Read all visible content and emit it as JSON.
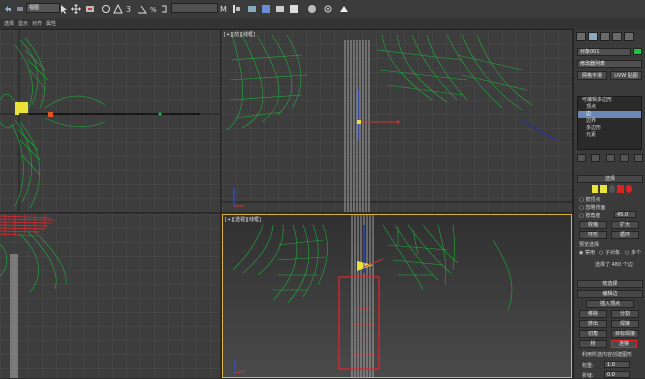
{
  "toolbar": {
    "selection_filter": "视图",
    "buttons": [
      "undo-icon",
      "redo-icon",
      "link-icon",
      "unlink-icon",
      "bind-icon",
      "select-icon",
      "select-by-name-icon",
      "rect-region-icon",
      "window-crossing-icon",
      "move-icon",
      "rotate-icon",
      "scale-icon",
      "snap-icon",
      "angle-snap-icon",
      "percent-snap-icon",
      "spinner-snap-icon",
      "named-selection-icon",
      "mirror-icon",
      "align-icon",
      "layer-icon",
      "curve-editor-icon",
      "schematic-icon",
      "material-editor-icon",
      "render-setup-icon",
      "render-frame-icon",
      "render-icon"
    ]
  },
  "menubar": {
    "items": [
      "选择",
      "显示",
      "对齐",
      "属性"
    ]
  },
  "viewports": {
    "top_left_label": "",
    "top_right_label": "[+][前][线框]",
    "bottom_left_label": "",
    "bottom_right_label": "[+][透视][线框]"
  },
  "command_panel": {
    "object_name": "对象001",
    "modifier_list": "修改器列表",
    "stack_buttons": [
      "网格平滑",
      "UVW 贴图"
    ],
    "stack_items": [
      {
        "label": "可编辑多边形",
        "selected": false
      },
      {
        "label": "顶点",
        "selected": false
      },
      {
        "label": "边",
        "selected": true
      },
      {
        "label": "边界",
        "selected": false
      },
      {
        "label": "多边形",
        "selected": false
      },
      {
        "label": "元素",
        "selected": false
      }
    ],
    "selection_rollout": "选择",
    "by_vertex": "按顶点",
    "ignore_backfacing": "忽略背面",
    "by_angle": "按角度",
    "angle_value": "45.0",
    "shrink": "收缩",
    "grow": "扩大",
    "ring": "环形",
    "loop": "循环",
    "preview_selection": "预览选择",
    "disabled": "禁用",
    "subobject": "子对象",
    "multi": "多个",
    "selected_status": "选择了 480 个边",
    "soft_selection": "软选择",
    "edit_edges": "编辑边",
    "insert_vertex": "插入顶点",
    "remove": "移除",
    "split": "分割",
    "extrude": "挤出",
    "weld": "焊接",
    "chamfer": "切角",
    "target_weld": "目标焊接",
    "bridge": "桥",
    "connect": "连接",
    "create_shape": "利用所选内容创建图形",
    "weight_label": "权重:",
    "weight_value": "1.0",
    "crease_label": "折缝:",
    "crease_value": "0.0"
  },
  "colors": {
    "accent_green": "#1ec43a",
    "highlight_red": "#e0232a",
    "active_viewport_border": "#d8b23b",
    "selected_stack": "#6a88b3"
  }
}
